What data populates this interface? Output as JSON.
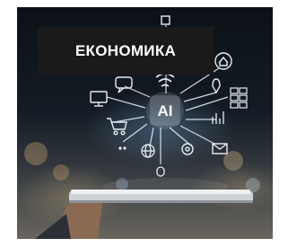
{
  "category_label": "ЕКОНОМИКА",
  "center_icon_text": "AI",
  "icons": [
    "wifi-icon",
    "home-icon",
    "chat-bubble-icon",
    "monitor-icon",
    "shopping-cart-icon",
    "grid-icon",
    "location-pin-icon",
    "bar-chart-icon",
    "globe-icon",
    "gear-icon",
    "mail-icon",
    "cloud-icon"
  ],
  "colors": {
    "tag_background": "#1a1a1a",
    "tag_text": "#ffffff",
    "icon_stroke": "#e8eef5"
  }
}
